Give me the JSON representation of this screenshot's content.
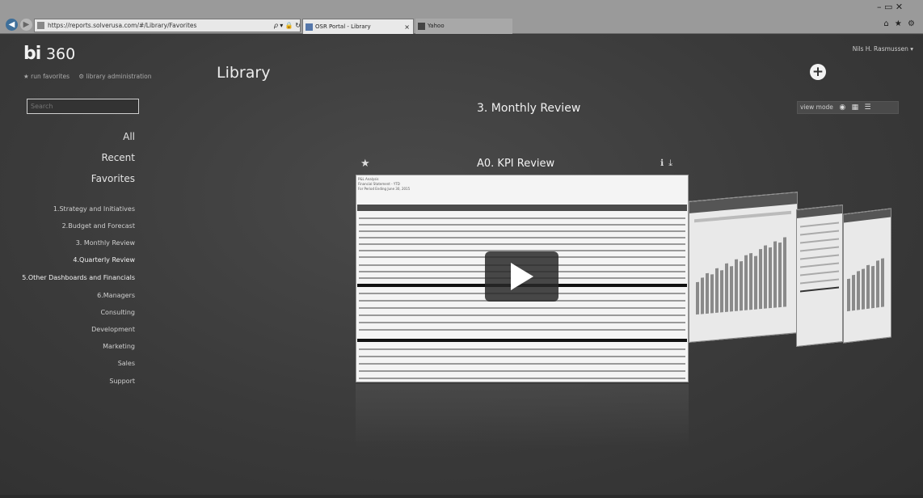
{
  "browser": {
    "url": "https://reports.solverusa.com/#/Library/Favorites",
    "url_controls": "𝜌 ▾ 🔒 ↻",
    "tabs": [
      {
        "label": "OSR Portal - Library",
        "close": "×"
      },
      {
        "label": "Yahoo"
      }
    ],
    "window_controls": "–  ▭  ✕",
    "toolbar_icons": "⌂ ★ ⚙"
  },
  "app": {
    "logo_brand": "bi",
    "logo_version": "360",
    "top_links": [
      "★ run favorites",
      "⚙ library administration"
    ],
    "page_title": "Library",
    "user": "Nils H. Rasmussen ▾",
    "search_placeholder": "Search",
    "section_title": "3. Monthly Review",
    "view_mode_label": "view mode"
  },
  "sidebar": {
    "categories": [
      "All",
      "Recent",
      "Favorites"
    ],
    "folders": [
      "1.Strategy and Initiatives",
      "2.Budget and Forecast",
      "3. Monthly Review",
      "4.Quarterly Review",
      "5.Other Dashboards and Financials",
      "6.Managers",
      "Consulting",
      "Development",
      "Marketing",
      "Sales",
      "Support"
    ]
  },
  "report": {
    "title": "A0. KPI Review",
    "header_lines": [
      "P&L Analysis",
      "Financial Statement - YTD",
      "For Period Ending June 30, 2015"
    ]
  }
}
